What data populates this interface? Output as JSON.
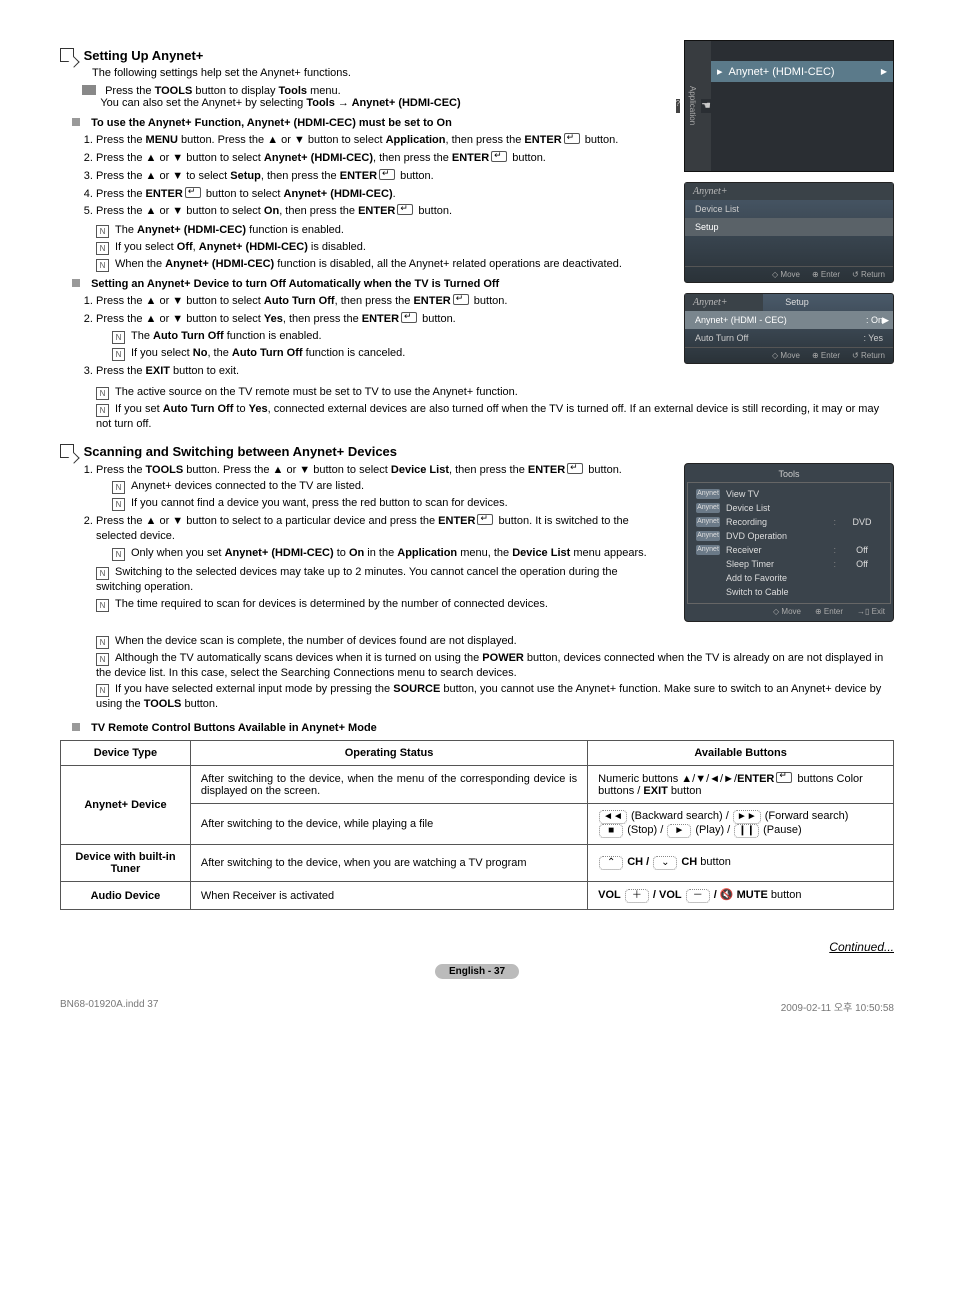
{
  "sections": {
    "s1": {
      "title": "Setting Up Anynet+",
      "intro": "The following settings help set the Anynet+ functions.",
      "tip_l1_a": "Press the ",
      "tip_l1_b": "TOOLS",
      "tip_l1_c": " button to display ",
      "tip_l1_d": "Tools",
      "tip_l1_e": " menu.",
      "tip_l2_a": "You can also set the Anynet+ by selecting ",
      "tip_l2_b": "Tools → Anynet+ (HDMI-CEC)"
    },
    "sub1": {
      "title": "To use the Anynet+ Function, Anynet+ (HDMI-CEC) must be set to On",
      "step1_a": "Press the ",
      "step1_b": "MENU",
      "step1_c": " button. Press the ▲ or ▼ button to select ",
      "step1_d": "Application",
      "step1_e": ", then press the ",
      "step1_f": "ENTER",
      "step1_g": " button.",
      "step2_a": "Press the ▲ or ▼ button to select ",
      "step2_b": "Anynet+ (HDMI-CEC)",
      "step2_c": ", then press the ",
      "step2_d": "ENTER",
      "step2_e": " button.",
      "step3_a": "Press the  ▲ or ▼  to select ",
      "step3_b": "Setup",
      "step3_c": ", then press the ",
      "step3_d": "ENTER",
      "step3_e": " button.",
      "step4_a": "Press the ",
      "step4_b": "ENTER",
      "step4_c": " button to select ",
      "step4_d": "Anynet+ (HDMI-CEC)",
      "step4_e": ".",
      "step5_a": "Press the ▲ or ▼ button to select ",
      "step5_b": "On",
      "step5_c": ", then press the ",
      "step5_d": "ENTER",
      "step5_e": " button.",
      "note1_a": "The ",
      "note1_b": "Anynet+ (HDMI-CEC)",
      "note1_c": " function is enabled.",
      "note2_a": "If you select ",
      "note2_b": "Off",
      "note2_c": ", ",
      "note2_d": "Anynet+ (HDMI-CEC)",
      "note2_e": " is disabled.",
      "note3_a": "When the ",
      "note3_b": "Anynet+ (HDMI-CEC)",
      "note3_c": " function is disabled, all the Anynet+ related operations are deactivated."
    },
    "sub2": {
      "title": "Setting an Anynet+ Device to turn Off Automatically when the TV is Turned Off",
      "step1_a": "Press the ▲ or ▼ button to select ",
      "step1_b": "Auto Turn Off",
      "step1_c": ", then press the ",
      "step1_d": "ENTER",
      "step1_e": " button.",
      "step2_a": "Press the ▲ or ▼ button to select ",
      "step2_b": "Yes",
      "step2_c": ", then press the ",
      "step2_d": "ENTER",
      "step2_e": " button.",
      "sub2a_a": "The ",
      "sub2a_b": "Auto Turn Off",
      "sub2a_c": " function is enabled.",
      "sub2b_a": "If you select ",
      "sub2b_b": "No",
      "sub2b_c": ", the ",
      "sub2b_d": "Auto Turn Off",
      "sub2b_e": " function is canceled.",
      "step3_a": "Press the ",
      "step3_b": "EXIT",
      "step3_c": " button to exit.",
      "note1": "The active source on the TV remote must be set to TV to use the Anynet+ function.",
      "note2_a": "If you set ",
      "note2_b": "Auto Turn Off",
      "note2_c": " to ",
      "note2_d": "Yes",
      "note2_e": ", connected external devices are also turned off when the TV is turned off. If an external device is still recording, it may or may not turn off."
    },
    "s2": {
      "title": "Scanning and Switching between Anynet+ Devices",
      "step1_a": "Press the ",
      "step1_b": "TOOLS",
      "step1_c": " button. Press the ▲ or ▼ button to select ",
      "step1_d": "Device List",
      "step1_e": ", then press the ",
      "step1_f": "ENTER",
      "step1_g": " button.",
      "sub1a": "Anynet+ devices connected to the TV are listed.",
      "sub1b": "If you cannot find a device you want, press the red button to scan for devices.",
      "step2_a": "Press the ▲ or ▼ button to select to a particular device and press the ",
      "step2_b": "ENTER",
      "step2_c": " button. It is switched to the selected device.",
      "sub2a_a": "Only when you set ",
      "sub2a_b": "Anynet+ (HDMI-CEC)",
      "sub2a_c": " to ",
      "sub2a_d": "On",
      "sub2a_e": " in the ",
      "sub2a_f": "Application",
      "sub2a_g": " menu, the ",
      "sub2a_h": "Device List",
      "sub2a_i": " menu appears.",
      "note1": "Switching to the selected devices may take up to 2 minutes. You cannot cancel the operation during the switching operation.",
      "note2": "The time required to scan for devices is determined by the number of connected devices.",
      "note3": "When the device scan is complete, the number of devices found are not displayed.",
      "note4_a": "Although the TV automatically scans devices when it is turned on using the ",
      "note4_b": "POWER",
      "note4_c": " button, devices connected when the TV is already on are not displayed in the device list. In this case, select the Searching Connections menu to search devices.",
      "note5_a": "If you have selected external input mode by pressing the ",
      "note5_b": "SOURCE",
      "note5_c": " button, you cannot use the Anynet+ function. Make sure to switch to an Anynet+ device by using the ",
      "note5_d": "TOOLS",
      "note5_e": " button."
    },
    "sub3": {
      "title": "TV Remote Control Buttons Available in Anynet+ Mode"
    },
    "table": {
      "headers": {
        "c1": "Device Type",
        "c2": "Operating Status",
        "c3": "Available Buttons"
      },
      "rows": [
        {
          "c1": "Anynet+ Device",
          "c2": "After switching to the device, when the menu of the corresponding device is displayed on the screen.",
          "c3_a": "Numeric buttons ▲/▼/◄/►/",
          "c3_b": "ENTER",
          "c3_c": " buttons Color buttons / ",
          "c3_d": "EXIT",
          "c3_e": " button"
        },
        {
          "c1": "",
          "c2": "After switching to the device, while playing a file",
          "c3_l1_a": " (Backward search) / ",
          "c3_l1_b": " (Forward search)",
          "c3_l2_a": " (Stop) / ",
          "c3_l2_b": " (Play) / ",
          "c3_l2_c": " (Pause)",
          "k1": "◄◄",
          "k2": "►►",
          "k3": "■",
          "k4": "►",
          "k5": "❙❙"
        },
        {
          "c1": "Device with built-in Tuner",
          "c2": "After switching to the device, when you are watching a TV program",
          "c3_b1": "CH /",
          "c3_b2": "CH",
          "c3_b3": " button",
          "up": "⌃",
          "down": "⌄"
        },
        {
          "c1": "Audio Device",
          "c2": "When Receiver is activated",
          "c3_b1": "VOL",
          "c3_b2": "/ VOL",
          "c3_b3": "/ ",
          "c3_b4": "MUTE",
          "c3_b5": " button",
          "plus": "＋",
          "minus": "－",
          "mute": "🔇"
        }
      ]
    },
    "osd1": {
      "header": "Anynet+ (HDMI-CEC)",
      "side": "Application"
    },
    "osd2": {
      "title": "Anynet+",
      "r1": "Device List",
      "r2": "Setup",
      "f1": "Move",
      "f2": "Enter",
      "f3": "Return"
    },
    "osd3": {
      "title": "Anynet+",
      "center": "Setup",
      "r1l": "Anynet+ (HDMI - CEC)",
      "r1v": ": On",
      "r2l": "Auto Turn Off",
      "r2v": ": Yes",
      "f1": "Move",
      "f2": "Enter",
      "f3": "Return"
    },
    "tools": {
      "title": "Tools",
      "rows": [
        {
          "label": "View TV",
          "val": "",
          "chip": true
        },
        {
          "label": "Device List",
          "val": "",
          "chip": true
        },
        {
          "label": "Recording",
          "sep": ":",
          "val": "DVD",
          "chip": true
        },
        {
          "label": "DVD Operation",
          "val": "",
          "chip": true
        },
        {
          "label": "Receiver",
          "sep": ":",
          "val": "Off",
          "chip": true
        },
        {
          "label": "Sleep Timer",
          "sep": ":",
          "val": "Off",
          "chip": false
        },
        {
          "label": "Add to Favorite",
          "val": "",
          "chip": false
        },
        {
          "label": "Switch to Cable",
          "val": "",
          "chip": false
        }
      ],
      "f1": "Move",
      "f2": "Enter",
      "f3": "Exit"
    }
  },
  "continued": "Continued...",
  "page": "English - 37",
  "footer_left": "BN68-01920A.indd   37",
  "footer_right": "2009-02-11   오후 10:50:58"
}
